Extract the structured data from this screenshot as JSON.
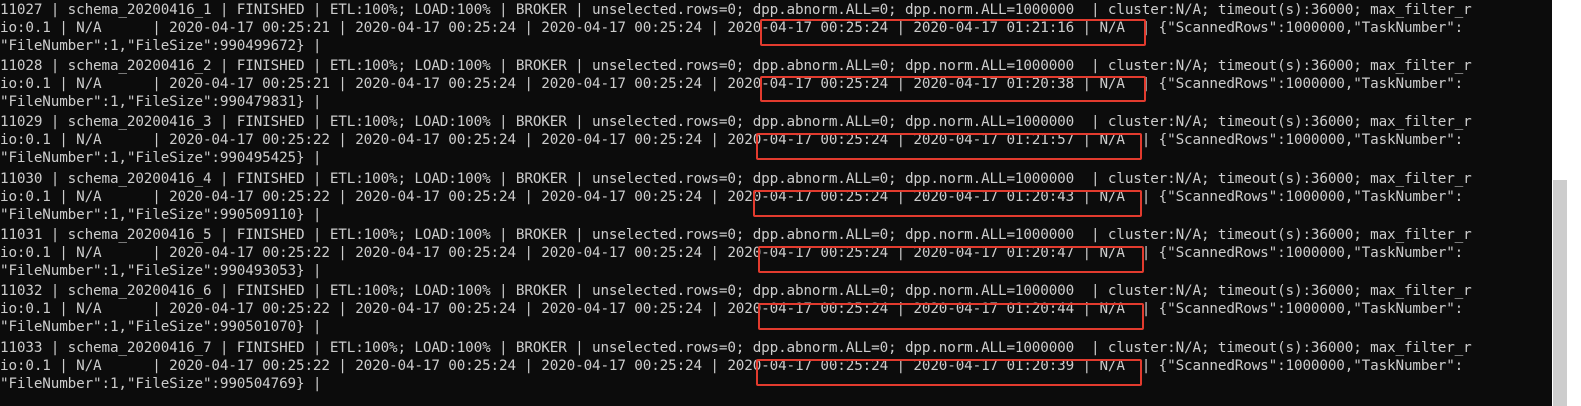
{
  "terminal": {
    "rows": [
      {
        "line1": "11027 | schema_20200416_1 | FINISHED | ETL:100%; LOAD:100% | BROKER | unselected.rows=0; dpp.abnorm.ALL=0; dpp.norm.ALL=1000000  | cluster:N/A; timeout(s):36000; max_filter_r",
        "line2": "io:0.1 | N/A      | 2020-04-17 00:25:21 | 2020-04-17 00:25:24 | 2020-04-17 00:25:24 | 2020-04-17 00:25:24 | 2020-04-17 01:21:16 | N/A  | {\"ScannedRows\":1000000,\"TaskNumber\":",
        "line3": "\"FileNumber\":1,\"FileSize\":990499672} |"
      },
      {
        "line1": "11028 | schema_20200416_2 | FINISHED | ETL:100%; LOAD:100% | BROKER | unselected.rows=0; dpp.abnorm.ALL=0; dpp.norm.ALL=1000000  | cluster:N/A; timeout(s):36000; max_filter_r",
        "line2": "io:0.1 | N/A      | 2020-04-17 00:25:21 | 2020-04-17 00:25:24 | 2020-04-17 00:25:24 | 2020-04-17 00:25:24 | 2020-04-17 01:20:38 | N/A  | {\"ScannedRows\":1000000,\"TaskNumber\":",
        "line3": "\"FileNumber\":1,\"FileSize\":990479831} |"
      },
      {
        "line1": "11029 | schema_20200416_3 | FINISHED | ETL:100%; LOAD:100% | BROKER | unselected.rows=0; dpp.abnorm.ALL=0; dpp.norm.ALL=1000000  | cluster:N/A; timeout(s):36000; max_filter_r",
        "line2": "io:0.1 | N/A      | 2020-04-17 00:25:22 | 2020-04-17 00:25:24 | 2020-04-17 00:25:24 | 2020-04-17 00:25:24 | 2020-04-17 01:21:57 | N/A  | {\"ScannedRows\":1000000,\"TaskNumber\":",
        "line3": "\"FileNumber\":1,\"FileSize\":990495425} |"
      },
      {
        "line1": "11030 | schema_20200416_4 | FINISHED | ETL:100%; LOAD:100% | BROKER | unselected.rows=0; dpp.abnorm.ALL=0; dpp.norm.ALL=1000000  | cluster:N/A; timeout(s):36000; max_filter_r",
        "line2": "io:0.1 | N/A      | 2020-04-17 00:25:22 | 2020-04-17 00:25:24 | 2020-04-17 00:25:24 | 2020-04-17 00:25:24 | 2020-04-17 01:20:43 | N/A  | {\"ScannedRows\":1000000,\"TaskNumber\":",
        "line3": "\"FileNumber\":1,\"FileSize\":990509110} |"
      },
      {
        "line1": "11031 | schema_20200416_5 | FINISHED | ETL:100%; LOAD:100% | BROKER | unselected.rows=0; dpp.abnorm.ALL=0; dpp.norm.ALL=1000000  | cluster:N/A; timeout(s):36000; max_filter_r",
        "line2": "io:0.1 | N/A      | 2020-04-17 00:25:22 | 2020-04-17 00:25:24 | 2020-04-17 00:25:24 | 2020-04-17 00:25:24 | 2020-04-17 01:20:47 | N/A  | {\"ScannedRows\":1000000,\"TaskNumber\":",
        "line3": "\"FileNumber\":1,\"FileSize\":990493053} |"
      },
      {
        "line1": "11032 | schema_20200416_6 | FINISHED | ETL:100%; LOAD:100% | BROKER | unselected.rows=0; dpp.abnorm.ALL=0; dpp.norm.ALL=1000000  | cluster:N/A; timeout(s):36000; max_filter_r",
        "line2": "io:0.1 | N/A      | 2020-04-17 00:25:22 | 2020-04-17 00:25:24 | 2020-04-17 00:25:24 | 2020-04-17 00:25:24 | 2020-04-17 01:20:44 | N/A  | {\"ScannedRows\":1000000,\"TaskNumber\":",
        "line3": "\"FileNumber\":1,\"FileSize\":990501070} |"
      },
      {
        "line1": "11033 | schema_20200416_7 | FINISHED | ETL:100%; LOAD:100% | BROKER | unselected.rows=0; dpp.abnorm.ALL=0; dpp.norm.ALL=1000000  | cluster:N/A; timeout(s):36000; max_filter_r",
        "line2": "io:0.1 | N/A      | 2020-04-17 00:25:22 | 2020-04-17 00:25:24 | 2020-04-17 00:25:24 | 2020-04-17 00:25:24 | 2020-04-17 01:20:39 | N/A  | {\"ScannedRows\":1000000,\"TaskNumber\":",
        "line3": "\"FileNumber\":1,\"FileSize\":990504769} |"
      }
    ]
  },
  "colors": {
    "background": "#0c0c0c",
    "text": "#cccccc",
    "highlight": "#e23b2e",
    "scrollbar_track": "#ffffff",
    "scrollbar_thumb": "#cdcdcd"
  }
}
